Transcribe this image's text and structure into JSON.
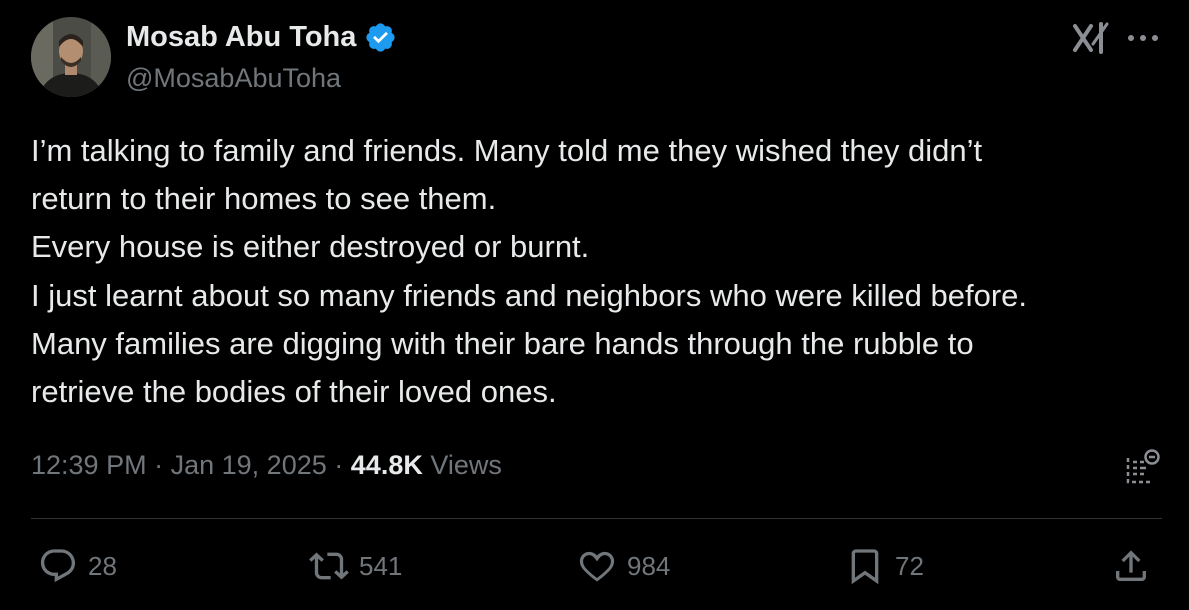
{
  "author": {
    "name": "Mosab Abu Toha",
    "handle": "@MosabAbuToha",
    "verified": true
  },
  "header_icons": [
    "grok-icon",
    "more-options-icon"
  ],
  "tweet": {
    "lines": [
      "I’m talking to family and friends. Many told me they wished they didn’t",
      "return to their homes to see them.",
      "Every house is either destroyed or burnt.",
      "I just learnt about so many friends and neighbors who were killed before.",
      "Many families are digging with their bare hands through the rubble to",
      "retrieve the bodies of their loved ones."
    ]
  },
  "meta": {
    "time": "12:39 PM",
    "separator": "·",
    "date": "Jan 19, 2025",
    "views_count": "44.8K",
    "views_label": "Views"
  },
  "actions": {
    "replies": "28",
    "reposts": "541",
    "likes": "984",
    "bookmarks": "72"
  },
  "colors": {
    "background": "#000000",
    "text": "#e7e9ea",
    "secondary": "#71767b",
    "divider": "#2f3336",
    "verified": "#1d9bf0"
  }
}
